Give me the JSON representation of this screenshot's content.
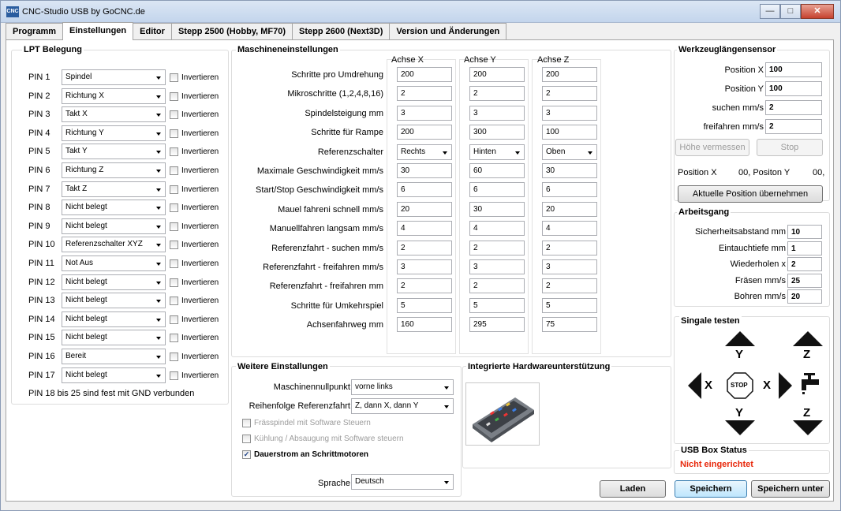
{
  "window": {
    "title": "CNC-Studio USB by GoCNC.de",
    "icon": "app-icon",
    "controls": [
      "minimize",
      "maximize",
      "close"
    ]
  },
  "tabs": [
    {
      "label": "Programm"
    },
    {
      "label": "Einstellungen"
    },
    {
      "label": "Editor"
    },
    {
      "label": "Stepp 2500 (Hobby, MF70)"
    },
    {
      "label": "Stepp 2600 (Next3D)"
    },
    {
      "label": "Version und Änderungen"
    }
  ],
  "lpt": {
    "title": "LPT Belegung",
    "invert_label": "Invertieren",
    "pins": [
      {
        "pin": "PIN 1",
        "value": "Spindel"
      },
      {
        "pin": "PIN 2",
        "value": "Richtung X"
      },
      {
        "pin": "PIN 3",
        "value": "Takt X"
      },
      {
        "pin": "PIN 4",
        "value": "Richtung Y"
      },
      {
        "pin": "PIN 5",
        "value": "Takt Y"
      },
      {
        "pin": "PIN 6",
        "value": "Richtung Z"
      },
      {
        "pin": "PIN 7",
        "value": "Takt Z"
      },
      {
        "pin": "PIN 8",
        "value": "Nicht belegt"
      },
      {
        "pin": "PIN 9",
        "value": "Nicht belegt"
      },
      {
        "pin": "PIN 10",
        "value": "Referenzschalter XYZ"
      },
      {
        "pin": "PIN 11",
        "value": "Not Aus"
      },
      {
        "pin": "PIN 12",
        "value": "Nicht belegt"
      },
      {
        "pin": "PIN 13",
        "value": "Nicht belegt"
      },
      {
        "pin": "PIN 14",
        "value": "Nicht belegt"
      },
      {
        "pin": "PIN 15",
        "value": "Nicht belegt"
      },
      {
        "pin": "PIN 16",
        "value": "Bereit"
      },
      {
        "pin": "PIN 17",
        "value": "Nicht belegt"
      }
    ],
    "footer": "PIN 18 bis 25 sind fest mit GND verbunden"
  },
  "machine": {
    "title": "Maschineneinstellungen",
    "axes": [
      "Achse X",
      "Achse Y",
      "Achse Z"
    ],
    "rows": [
      {
        "label": "Schritte pro Umdrehung",
        "values": [
          "200",
          "200",
          "200"
        ]
      },
      {
        "label": "Mikroschritte (1,2,4,8,16)",
        "values": [
          "2",
          "2",
          "2"
        ]
      },
      {
        "label": "Spindelsteigung mm",
        "values": [
          "3",
          "3",
          "3"
        ]
      },
      {
        "label": "Schritte für Rampe",
        "values": [
          "200",
          "300",
          "100"
        ]
      },
      {
        "label": "Referenzschalter",
        "values": [
          "Rechts",
          "Hinten",
          "Oben"
        ],
        "select": true
      },
      {
        "label": "Maximale Geschwindigkeit mm/s",
        "values": [
          "30",
          "60",
          "30"
        ]
      },
      {
        "label": "Start/Stop Geschwindigkeit mm/s",
        "values": [
          "6",
          "6",
          "6"
        ]
      },
      {
        "label": "Mauel fahreni schnell mm/s",
        "values": [
          "20",
          "30",
          "20"
        ]
      },
      {
        "label": "Manuellfahren langsam mm/s",
        "values": [
          "4",
          "4",
          "4"
        ]
      },
      {
        "label": "Referenzfahrt - suchen mm/s",
        "values": [
          "2",
          "2",
          "2"
        ]
      },
      {
        "label": "Referenzfahrt - freifahren mm/s",
        "values": [
          "3",
          "3",
          "3"
        ]
      },
      {
        "label": "Referenzfahrt - freifahren mm",
        "values": [
          "2",
          "2",
          "2"
        ]
      },
      {
        "label": "Schritte für Umkehrspiel",
        "values": [
          "5",
          "5",
          "5"
        ]
      },
      {
        "label": "Achsenfahrweg mm",
        "values": [
          "160",
          "295",
          "75"
        ]
      }
    ]
  },
  "weitere": {
    "title": "Weitere Einstallungen",
    "nullpunkt_label": "Maschinennullpunkt",
    "nullpunkt_value": "vorne links",
    "reihenfolge_label": "Reihenfolge Referenzfahrt",
    "reihenfolge_value": "Z, dann X, dann Y",
    "cb_spindel": "Frässpindel mit Software Steuern",
    "cb_kuehlung": "Kühlung / Absaugung mit Software steuern",
    "cb_dauerstrom": "Dauerstrom an Schrittmotoren",
    "sprache_label": "Sprache",
    "sprache_value": "Deutsch"
  },
  "hardware": {
    "title": "Integrierte Hardwareunterstützung"
  },
  "sensor": {
    "title": "Werkzeuglängensensor",
    "pos_x_label": "Position X",
    "pos_x": "100",
    "pos_y_label": "Position Y",
    "pos_y": "100",
    "suchen_label": "suchen mm/s",
    "suchen": "2",
    "frei_label": "freifahren mm/s",
    "frei": "2",
    "btn_measure": "Höhe vermessen",
    "btn_stop": "Stop",
    "status_x": "Position X",
    "status_y": "00, Positon Y",
    "status_end": "00,",
    "btn_take": "Aktuelle Position übernehmen"
  },
  "arbeit": {
    "title": "Arbeitsgang",
    "rows": [
      {
        "label": "Sicherheitsabstand mm",
        "value": "10"
      },
      {
        "label": "Eintauchtiefe mm",
        "value": "1"
      },
      {
        "label": "Wiederholen x",
        "value": "2"
      },
      {
        "label": "Fräsen mm/s",
        "value": "25"
      },
      {
        "label": "Bohren mm/s",
        "value": "20"
      }
    ]
  },
  "signal": {
    "title": "Singale testen",
    "y": "Y",
    "z": "Z",
    "x": "X",
    "stop": "STOP"
  },
  "usb": {
    "title": "USB Box Status",
    "status": "Nicht eingerichtet",
    "status_color": "#e8280b"
  },
  "buttons": {
    "laden": "Laden",
    "speichern": "Speichern",
    "speichern_unter": "Speichern unter"
  }
}
